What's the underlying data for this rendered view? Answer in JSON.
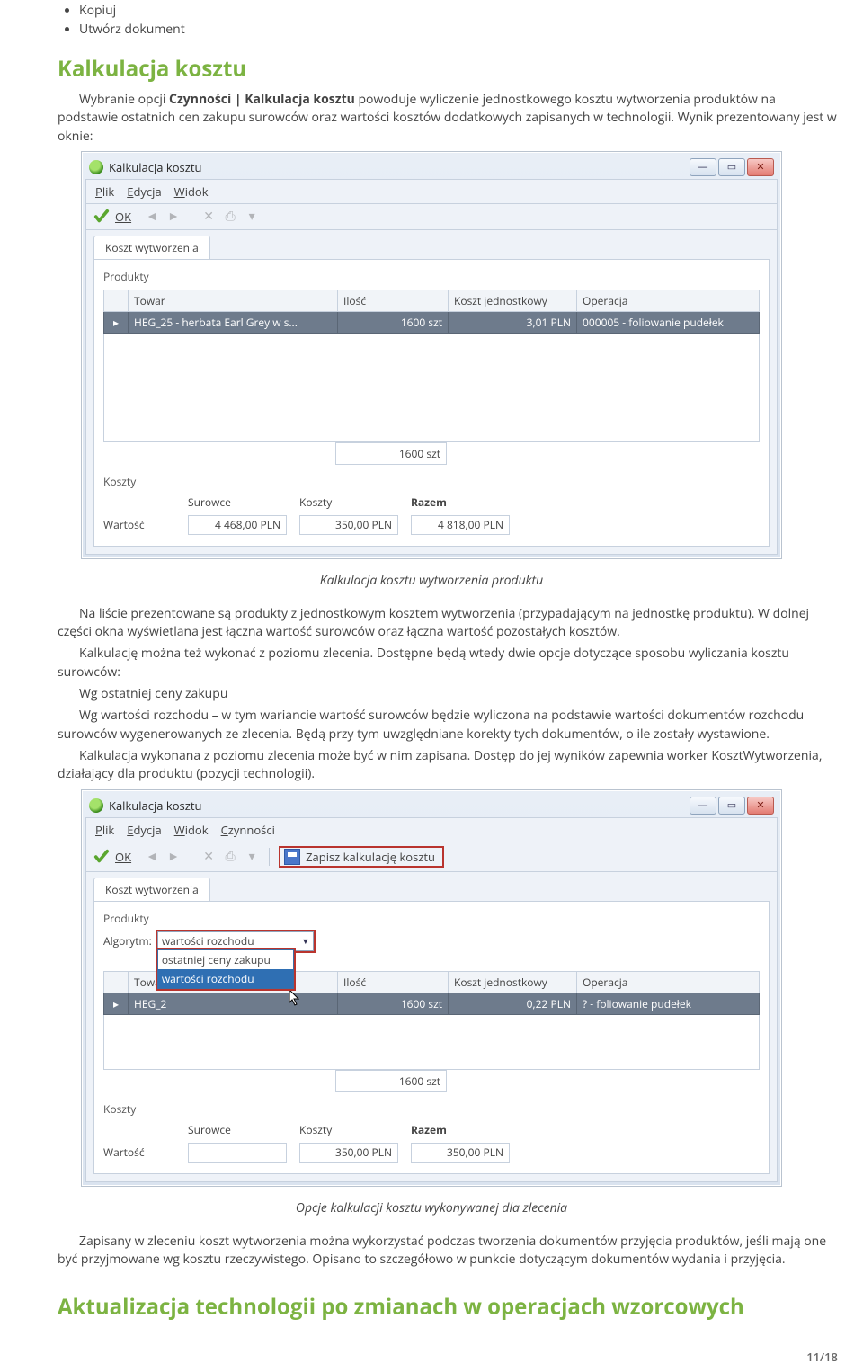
{
  "bullets": {
    "b1": "Kopiuj",
    "b2": "Utwórz dokument"
  },
  "h_kalk": "Kalkulacja kosztu",
  "p1a": "Wybranie opcji ",
  "p1b": "Czynności | Kalkulacja kosztu",
  "p1c": " powoduje wyliczenie jednostkowego kosztu wytworzenia produktów na podstawie ostatnich cen zakupu surowców oraz wartości kosztów dodatkowych zapisanych w technologii. Wynik prezentowany jest w oknie:",
  "win1": {
    "title": "Kalkulacja kosztu",
    "menu": {
      "plik": "Plik",
      "edycja": "Edycja",
      "widok": "Widok"
    },
    "ok": "OK",
    "tab": "Koszt wytworzenia",
    "grp_prod": "Produkty",
    "cols": {
      "towar": "Towar",
      "ilosc": "Ilość",
      "kj": "Koszt jednostkowy",
      "oper": "Operacja"
    },
    "row": {
      "towar": "HEG_25 - herbata Earl Grey w s...",
      "ilosc": "1600 szt",
      "kj": "3,01 PLN",
      "oper": "000005 - foliowanie pudełek"
    },
    "sum_ilosc": "1600 szt",
    "grp_koszt": "Koszty",
    "costs": {
      "sur_h": "Surowce",
      "kos_h": "Koszty",
      "raz_h": "Razem",
      "war": "Wartość",
      "sur": "4 468,00 PLN",
      "kos": "350,00 PLN",
      "raz": "4 818,00 PLN"
    }
  },
  "cap1": "Kalkulacja kosztu wytworzenia produktu",
  "p2": "Na liście prezentowane są produkty z jednostkowym kosztem wytworzenia (przypadającym na jednostkę produktu). W dolnej części okna wyświetlana jest łączna wartość surowców oraz łączna wartość pozostałych kosztów.",
  "p3": "Kalkulację można też wykonać z poziomu zlecenia. Dostępne będą wtedy dwie opcje dotyczące sposobu wyliczania kosztu surowców:",
  "p4": "Wg ostatniej ceny zakupu",
  "p5": "Wg wartości rozchodu – w tym wariancie wartość surowców będzie wyliczona na podstawie wartości dokumentów rozchodu surowców wygenerowanych ze zlecenia. Będą przy tym uwzględniane korekty tych dokumentów, o ile zostały wystawione.",
  "p6": "Kalkulacja wykonana z poziomu zlecenia może być w nim zapisana. Dostęp do jej wyników zapewnia worker KosztWytworzenia, działający dla produktu (pozycji technologii).",
  "win2": {
    "title": "Kalkulacja kosztu",
    "menu": {
      "plik": "Plik",
      "edycja": "Edycja",
      "widok": "Widok",
      "czyn": "Czynności"
    },
    "ok": "OK",
    "save": "Zapisz kalkulację kosztu",
    "tab": "Koszt wytworzenia",
    "grp_prod": "Produkty",
    "alg_label": "Algorytm:",
    "alg_value": "wartości rozchodu",
    "opts": {
      "o1": "ostatniej ceny zakupu",
      "o2": "wartości rozchodu"
    },
    "cols": {
      "towar": "Towar",
      "ilosc": "Ilość",
      "kj": "Koszt jednostkowy",
      "oper": "Operacja"
    },
    "row": {
      "towar": "HEG_2",
      "ilosc": "1600 szt",
      "kj": "0,22 PLN",
      "oper": "? - foliowanie pudełek"
    },
    "sum_ilosc": "1600 szt",
    "grp_koszt": "Koszty",
    "costs": {
      "sur_h": "Surowce",
      "kos_h": "Koszty",
      "raz_h": "Razem",
      "war": "Wartość",
      "sur": "",
      "kos": "350,00 PLN",
      "raz": "350,00 PLN"
    }
  },
  "cap2": "Opcje kalkulacji kosztu wykonywanej dla zlecenia",
  "p7": "Zapisany w zleceniu koszt wytworzenia można wykorzystać podczas tworzenia dokumentów przyjęcia produktów, jeśli mają one być przyjmowane wg kosztu rzeczywistego. Opisano to szczegółowo w punkcie dotyczącym dokumentów wydania i przyjęcia.",
  "h_akt": "Aktualizacja technologii po zmianach w operacjach wzorcowych",
  "pagenum": "11/18"
}
